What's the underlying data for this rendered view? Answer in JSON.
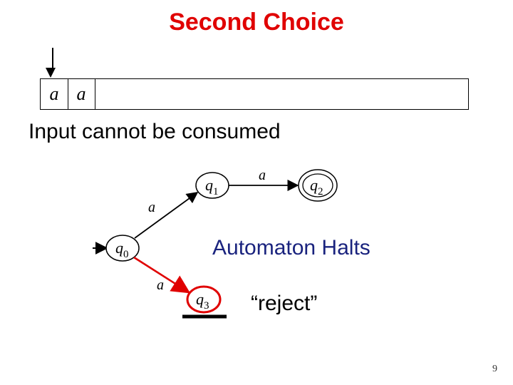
{
  "title": "Second Choice",
  "subtitle": "Input cannot be consumed",
  "halts_text": "Automaton Halts",
  "reject_text": "“reject”",
  "page_number": "9",
  "tape": {
    "cells": [
      "a",
      "a"
    ],
    "head_index": 0
  },
  "automaton": {
    "states": [
      {
        "id": "q0",
        "label_base": "q",
        "label_sub": "0",
        "start": true,
        "accept": false,
        "highlight": false
      },
      {
        "id": "q1",
        "label_base": "q",
        "label_sub": "1",
        "start": false,
        "accept": false,
        "highlight": false
      },
      {
        "id": "q2",
        "label_base": "q",
        "label_sub": "2",
        "start": false,
        "accept": true,
        "highlight": false
      },
      {
        "id": "q3",
        "label_base": "q",
        "label_sub": "3",
        "start": false,
        "accept": false,
        "highlight": true
      }
    ],
    "transitions": [
      {
        "from": "q0",
        "to": "q1",
        "label": "a",
        "highlight": false
      },
      {
        "from": "q1",
        "to": "q2",
        "label": "a",
        "highlight": false
      },
      {
        "from": "q0",
        "to": "q3",
        "label": "a",
        "highlight": true
      }
    ]
  }
}
